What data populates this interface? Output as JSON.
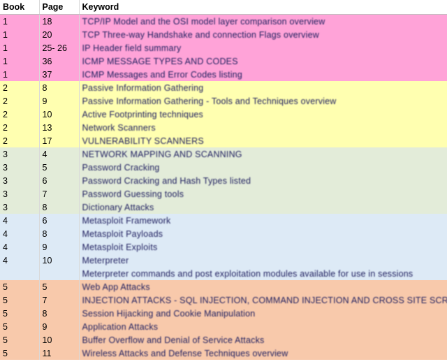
{
  "header": {
    "book": "Book",
    "page": "Page",
    "keyword": "Keyword"
  },
  "colors": {
    "book1": "#ffa3d8",
    "book2": "#ffffb0",
    "book3": "#e3ecd9",
    "book4": "#ddeaf6",
    "book5": "#f8c9ab",
    "keyword_text_dark": "#202060"
  },
  "rows": [
    {
      "book": "1",
      "page": "18",
      "group": "book1",
      "keyword": "TCP/IP Model and the OSI model layer comparison overview"
    },
    {
      "book": "1",
      "page": "20",
      "group": "book1",
      "keyword": "TCP Three-way Handshake and connection Flags overview"
    },
    {
      "book": "1",
      "page": "25- 26",
      "group": "book1",
      "keyword": "IP Header field summary"
    },
    {
      "book": "1",
      "page": "36",
      "group": "book1",
      "keyword": "ICMP MESSAGE TYPES AND CODES"
    },
    {
      "book": "1",
      "page": "37",
      "group": "book1",
      "keyword": "ICMP Messages and Error Codes listing"
    },
    {
      "book": "2",
      "page": "8",
      "group": "book2",
      "keyword": "Passive Information Gathering"
    },
    {
      "book": "2",
      "page": "9",
      "group": "book2",
      "keyword": "Passive Information Gathering - Tools and Techniques overview"
    },
    {
      "book": "2",
      "page": "10",
      "group": "book2",
      "keyword": "Active Footprinting techniques"
    },
    {
      "book": "2",
      "page": "13",
      "group": "book2",
      "keyword": "Network Scanners"
    },
    {
      "book": "2",
      "page": "17",
      "group": "book2",
      "keyword": "VULNERABILITY SCANNERS"
    },
    {
      "book": "3",
      "page": "4",
      "group": "book3",
      "keyword": "NETWORK MAPPING AND SCANNING"
    },
    {
      "book": "3",
      "page": "5",
      "group": "book3",
      "keyword": "Password Cracking"
    },
    {
      "book": "3",
      "page": "6",
      "group": "book3",
      "keyword": "Password Cracking and Hash Types listed"
    },
    {
      "book": "3",
      "page": "7",
      "group": "book3",
      "keyword": "Password Guessing tools"
    },
    {
      "book": "3",
      "page": "8",
      "group": "book3",
      "keyword": "Dictionary Attacks"
    },
    {
      "book": "4",
      "page": "6",
      "group": "book4",
      "keyword": "Metasploit Framework"
    },
    {
      "book": "4",
      "page": "8",
      "group": "book4",
      "keyword": "Metasploit Payloads"
    },
    {
      "book": "4",
      "page": "9",
      "group": "book4",
      "keyword": "Metasploit Exploits"
    },
    {
      "book": "4",
      "page": "10",
      "group": "book4",
      "keyword": "Meterpreter"
    },
    {
      "book": "",
      "page": "",
      "group": "book4",
      "keyword": "Meterpreter commands and post exploitation modules available for use in sessions"
    },
    {
      "book": "5",
      "page": "5",
      "group": "book5",
      "keyword": "Web App Attacks"
    },
    {
      "book": "5",
      "page": "7",
      "group": "book5",
      "keyword": "INJECTION ATTACKS - SQL INJECTION, COMMAND INJECTION AND CROSS SITE SCRIPTING (XSS)"
    },
    {
      "book": "5",
      "page": "8",
      "group": "book5",
      "keyword": "Session Hijacking and Cookie Manipulation"
    },
    {
      "book": "5",
      "page": "9",
      "group": "book5",
      "keyword": "Application Attacks"
    },
    {
      "book": "5",
      "page": "10",
      "group": "book5",
      "keyword": "Buffer Overflow and Denial of Service Attacks"
    },
    {
      "book": "5",
      "page": "11",
      "group": "book5",
      "keyword": "Wireless Attacks and Defense Techniques overview"
    }
  ]
}
